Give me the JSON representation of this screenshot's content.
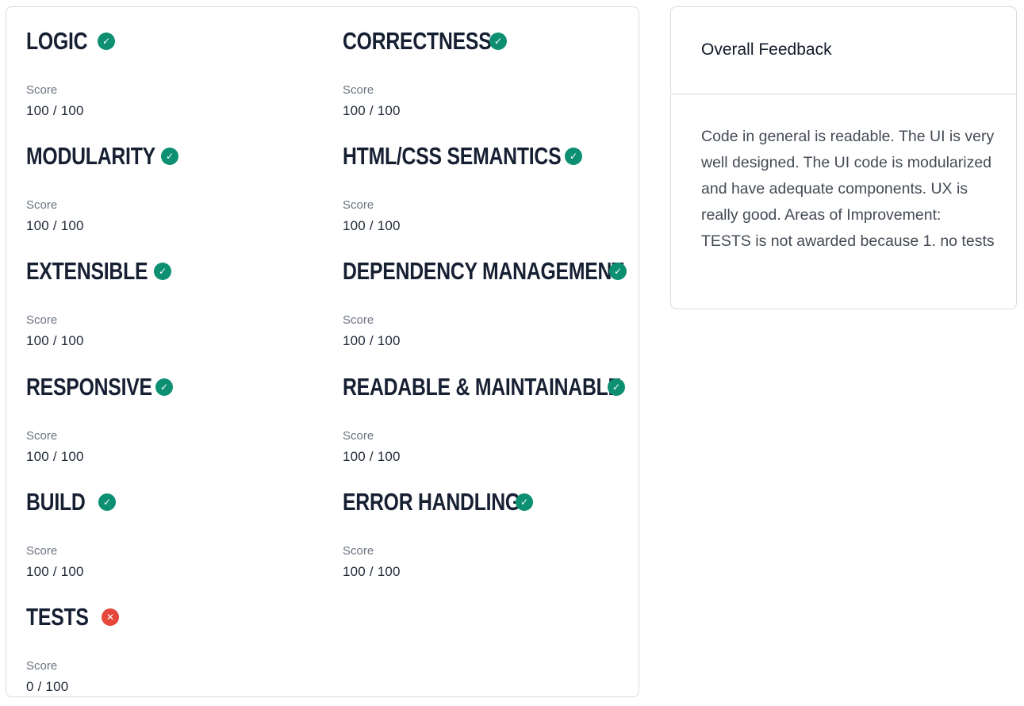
{
  "metrics": [
    {
      "name": "LOGIC",
      "score_label": "Score",
      "score": "100 / 100",
      "status": "pass",
      "icon": "check-icon"
    },
    {
      "name": "CORRECTNESS",
      "score_label": "Score",
      "score": "100 / 100",
      "status": "pass",
      "icon": "check-icon"
    },
    {
      "name": "MODULARITY",
      "score_label": "Score",
      "score": "100 / 100",
      "status": "pass",
      "icon": "check-icon"
    },
    {
      "name": "HTML/CSS SEMANTICS",
      "score_label": "Score",
      "score": "100 / 100",
      "status": "pass",
      "icon": "check-icon"
    },
    {
      "name": "EXTENSIBLE",
      "score_label": "Score",
      "score": "100 / 100",
      "status": "pass",
      "icon": "check-icon"
    },
    {
      "name": "DEPENDENCY MANAGEMENT",
      "score_label": "Score",
      "score": "100 / 100",
      "status": "pass",
      "icon": "check-icon"
    },
    {
      "name": "RESPONSIVE",
      "score_label": "Score",
      "score": "100 / 100",
      "status": "pass",
      "icon": "check-icon"
    },
    {
      "name": "READABLE & MAINTAINABLE",
      "score_label": "Score",
      "score": "100 / 100",
      "status": "pass",
      "icon": "check-icon"
    },
    {
      "name": "BUILD",
      "score_label": "Score",
      "score": "100 / 100",
      "status": "pass",
      "icon": "check-icon"
    },
    {
      "name": "ERROR HANDLING",
      "score_label": "Score",
      "score": "100 / 100",
      "status": "pass",
      "icon": "check-icon"
    },
    {
      "name": "TESTS",
      "score_label": "Score",
      "score": "0 / 100",
      "status": "fail",
      "icon": "cross-icon"
    }
  ],
  "feedback": {
    "title": "Overall Feedback",
    "text": "Code in general is readable. The UI is very well designed. The UI code is modularized and have adequate components. UX is really good. Areas of Improvement: TESTS is not awarded because 1. no tests"
  },
  "colors": {
    "pass": "#0d8f72",
    "fail": "#e5473b",
    "title": "#172033",
    "border": "#d7dbe0"
  }
}
